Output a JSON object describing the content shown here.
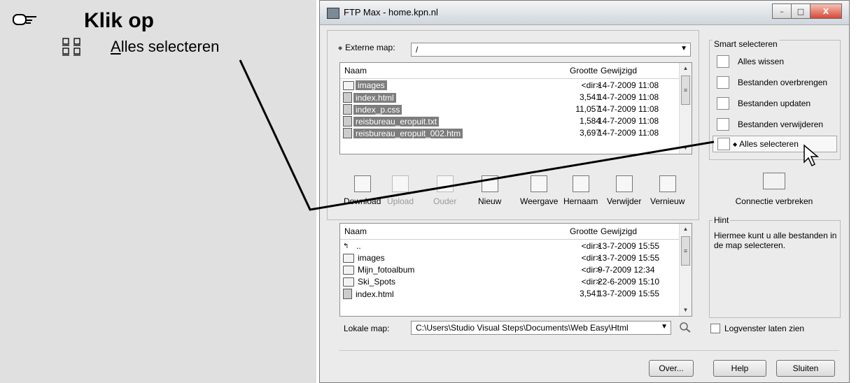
{
  "instruction": {
    "heading": "Klik op",
    "action_label_underlined": "A",
    "action_label_rest": "lles selecteren"
  },
  "window": {
    "title": "FTP Max - home.kpn.nl",
    "minimize_glyph": "–",
    "maximize_glyph": "□",
    "close_glyph": "X"
  },
  "external_map": {
    "label": "Externe map:",
    "value": "/"
  },
  "columns": {
    "name": "Naam",
    "size": "Grootte",
    "modified": "Gewijzigd"
  },
  "remote_files": [
    {
      "name": "images",
      "size": "<dir>",
      "date": "14-7-2009 11:08",
      "icon": "folder-icon"
    },
    {
      "name": "index.html",
      "size": "3,541",
      "date": "14-7-2009 11:08",
      "icon": "html-file-icon"
    },
    {
      "name": "index_p.css",
      "size": "11,057",
      "date": "14-7-2009 11:08",
      "icon": "file-icon"
    },
    {
      "name": "reisbureau_eropuit.txt",
      "size": "1,584",
      "date": "14-7-2009 11:08",
      "icon": "file-icon"
    },
    {
      "name": "reisbureau_eropuit_002.htm",
      "size": "3,697",
      "date": "14-7-2009 11:08",
      "icon": "html-file-icon"
    }
  ],
  "toolbar": {
    "download": "Download",
    "upload": "Upload",
    "parent": "Ouder",
    "new": "Nieuw",
    "view": "Weergave",
    "rename": "Hernaam",
    "delete": "Verwijder",
    "refresh": "Vernieuw"
  },
  "local_files": [
    {
      "name": "..",
      "size": "<dir>",
      "date": "13-7-2009 15:55",
      "icon": "up-folder-icon"
    },
    {
      "name": "images",
      "size": "<dir>",
      "date": "13-7-2009 15:55",
      "icon": "folder-icon"
    },
    {
      "name": "Mijn_fotoalbum",
      "size": "<dir>",
      "date": "9-7-2009 12:34",
      "icon": "folder-icon"
    },
    {
      "name": "Ski_Spots",
      "size": "<dir>",
      "date": "22-6-2009 15:10",
      "icon": "folder-icon"
    },
    {
      "name": "index.html",
      "size": "3,541",
      "date": "13-7-2009 15:55",
      "icon": "html-file-icon"
    }
  ],
  "local_map": {
    "label": "Lokale map:",
    "value": "C:\\Users\\Studio Visual Steps\\Documents\\Web Easy\\Html"
  },
  "smart": {
    "title": "Smart selecteren",
    "items": [
      "Alles wissen",
      "Bestanden overbrengen",
      "Bestanden updaten",
      "Bestanden verwijderen",
      "Alles selecteren"
    ]
  },
  "disconnect_label": "Connectie verbreken",
  "hint": {
    "title": "Hint",
    "text": "Hiermee kunt u alle bestanden in de map selecteren."
  },
  "log_checkbox_label": "Logvenster laten zien",
  "buttons": {
    "about": "Over...",
    "help": "Help",
    "close": "Sluiten"
  }
}
